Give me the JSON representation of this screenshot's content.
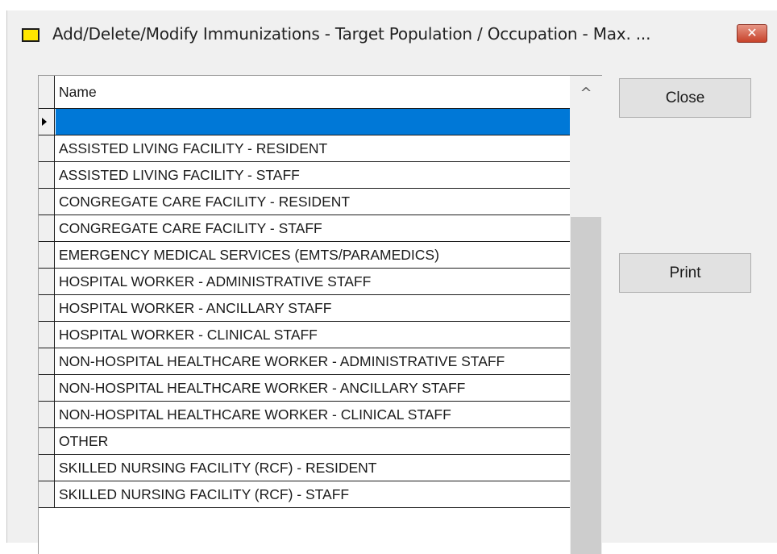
{
  "window": {
    "title": "Add/Delete/Modify Immunizations - Target Population / Occupation - Max. ...",
    "close_glyph": "✕"
  },
  "grid": {
    "column_header": "Name",
    "current_row_indicator": "arrow-pointer",
    "selected_row_color": "#0078d7",
    "rows": [
      "",
      "ASSISTED LIVING FACILITY - RESIDENT",
      "ASSISTED LIVING FACILITY - STAFF",
      "CONGREGATE CARE FACILITY - RESIDENT",
      "CONGREGATE CARE FACILITY - STAFF",
      "EMERGENCY MEDICAL SERVICES (EMTS/PARAMEDICS)",
      "HOSPITAL WORKER - ADMINISTRATIVE STAFF",
      "HOSPITAL WORKER - ANCILLARY STAFF",
      "HOSPITAL WORKER - CLINICAL STAFF",
      "NON-HOSPITAL HEALTHCARE WORKER - ADMINISTRATIVE STAFF",
      "NON-HOSPITAL HEALTHCARE WORKER - ANCILLARY STAFF",
      "NON-HOSPITAL HEALTHCARE WORKER - CLINICAL STAFF",
      "OTHER",
      "SKILLED NURSING FACILITY (RCF) - RESIDENT",
      "SKILLED NURSING FACILITY (RCF) - STAFF"
    ],
    "scroll_up_glyph": "^"
  },
  "buttons": {
    "close_label": "Close",
    "print_label": "Print"
  }
}
